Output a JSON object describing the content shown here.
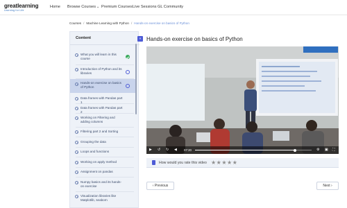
{
  "nav": {
    "logo": {
      "brand": "greatlearning",
      "tagline": "Learning for Life"
    },
    "items": [
      {
        "label": "Home"
      },
      {
        "label": "Browse Courses",
        "chevron": "⌄"
      },
      {
        "label": "Premium Courses"
      },
      {
        "label": "Live Sessions"
      },
      {
        "label": "GL Community"
      }
    ]
  },
  "breadcrumb": {
    "items": [
      "Courses",
      "Machine Learning with Python",
      "Hands-on exercise on basics of Python"
    ],
    "separator": "/"
  },
  "sidebar": {
    "title": "Content",
    "collapse_icon": "«",
    "lessons": [
      {
        "title": "What you will learn in this course",
        "status": "completed"
      },
      {
        "title": "Introduction of Python and its libraries",
        "status": "pending"
      },
      {
        "title": "Hands-on exercise on basics of Python",
        "status": "pending",
        "active": true
      },
      {
        "title": "Data frames with Pandas part 1",
        "status": "none"
      },
      {
        "title": "Data frames with Pandas part 2",
        "status": "none"
      },
      {
        "title": "Working on Filtering and adding columns",
        "status": "none"
      },
      {
        "title": "Filtering part 2 and Sorting",
        "status": "none"
      },
      {
        "title": "Grouping the data",
        "status": "none"
      },
      {
        "title": "Loops and functions",
        "status": "none"
      },
      {
        "title": "Working on apply method",
        "status": "none"
      },
      {
        "title": "Assignment on pandas",
        "status": "none"
      },
      {
        "title": "Numpy basics and its hands-on exercise",
        "status": "none"
      },
      {
        "title": "Visualization libraries like Matplotlib, seaborn",
        "status": "none"
      }
    ]
  },
  "main": {
    "title": "Hands-on exercise on basics of Python",
    "player": {
      "current_time": "07:20",
      "progress": 0.86,
      "icons": [
        "play-icon",
        "rewind-icon",
        "forward-icon",
        "volume-icon",
        "settings-icon",
        "pip-icon",
        "fullscreen-icon"
      ]
    },
    "rating": {
      "question": "How would you rate this video",
      "stars": 5,
      "star_color": "#8f8f8f"
    },
    "pager": {
      "prev_label": "Previous",
      "next_label": "Next"
    }
  },
  "colors": {
    "accent": "#4d5bd6",
    "completed": "#3aaa5c",
    "sidebar_bg": "#eef2f8",
    "active_lesson_bg": "#c9d4ec"
  }
}
